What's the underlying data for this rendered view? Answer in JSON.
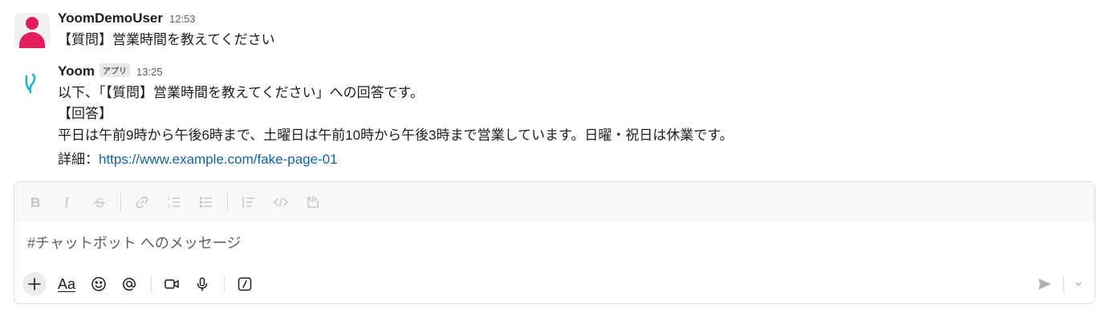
{
  "messages": [
    {
      "author": "YoomDemoUser",
      "time": "12:53",
      "lines": [
        "【質問】営業時間を教えてください"
      ]
    },
    {
      "author": "Yoom",
      "badge": "アプリ",
      "time": "13:25",
      "lines": [
        "以下、「【質問】営業時間を教えてください」への回答です。",
        "【回答】",
        "平日は午前9時から午後6時まで、土曜日は午前10時から午後3時まで営業しています。日曜・祝日は休業です。"
      ],
      "detail_label": "詳細：",
      "detail_link": "https://www.example.com/fake-page-01"
    }
  ],
  "composer": {
    "placeholder": "#チャットボット へのメッセージ",
    "format_tools": [
      "bold-icon",
      "italic-icon",
      "strikethrough-icon",
      "link-icon",
      "ordered-list-icon",
      "bulleted-list-icon",
      "blockquote-icon",
      "code-icon",
      "code-block-icon"
    ],
    "bottom_tools": [
      "plus-icon",
      "formatting-aa-icon",
      "emoji-icon",
      "mention-icon",
      "video-icon",
      "microphone-icon",
      "shortcuts-slash-icon",
      "send-icon",
      "chevron-down-icon"
    ],
    "formatting_label": "Aa"
  },
  "colors": {
    "user_avatar": "#e01e5a",
    "app_logo": "#18b7c8",
    "link": "#1264a3"
  }
}
